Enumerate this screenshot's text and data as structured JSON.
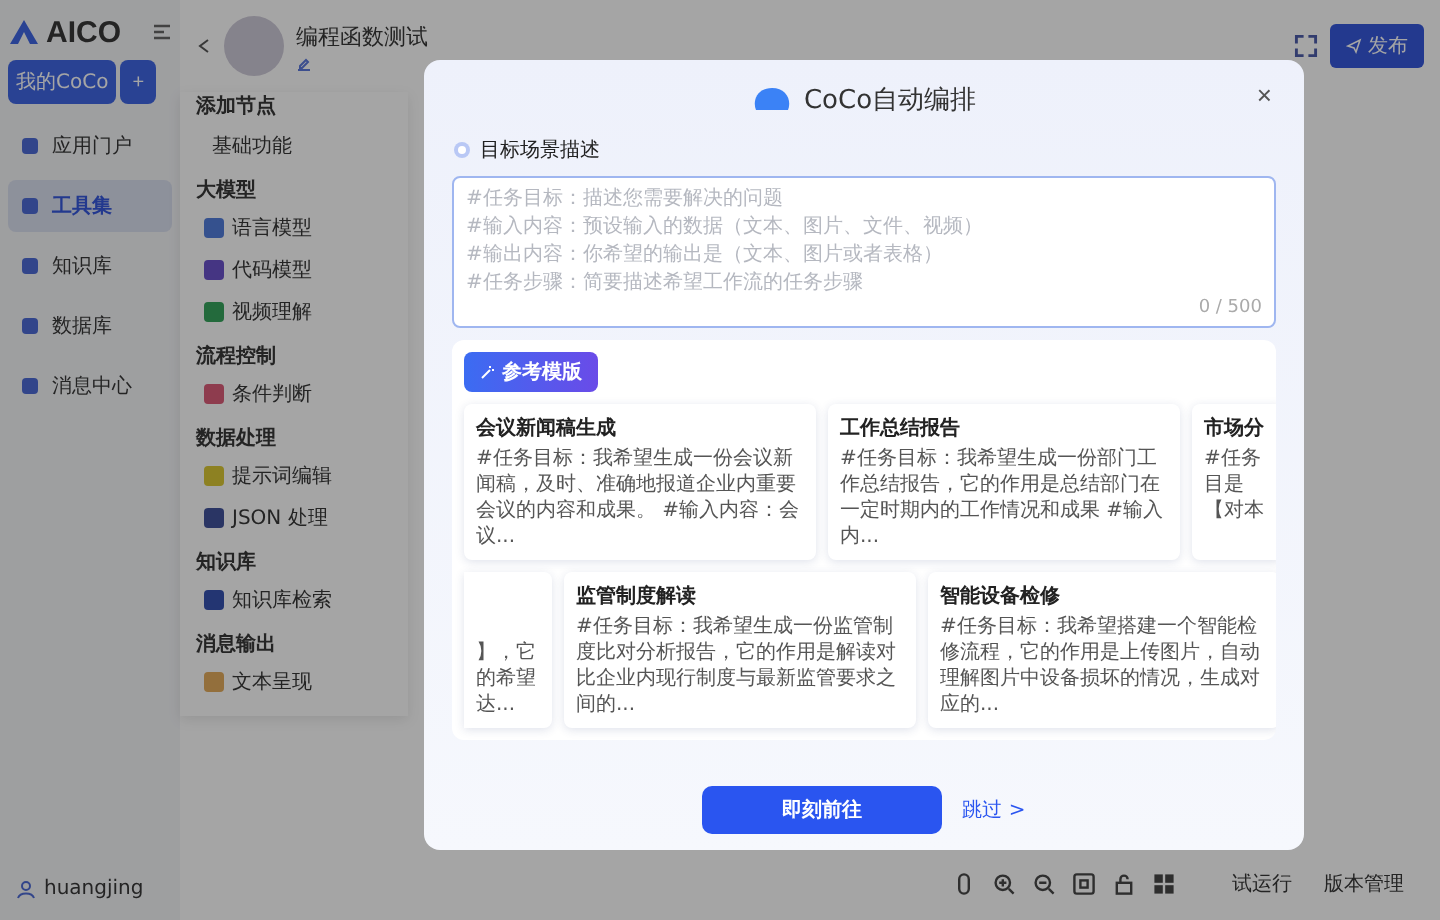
{
  "sidebar": {
    "logo": "AICO",
    "my_button": "我的CoCo",
    "add_button": "+",
    "items": [
      {
        "label": "应用门户",
        "selected": false
      },
      {
        "label": "工具集",
        "selected": true
      },
      {
        "label": "知识库",
        "selected": false
      },
      {
        "label": "数据库",
        "selected": false
      },
      {
        "label": "消息中心",
        "selected": false
      }
    ],
    "user": "huangjing"
  },
  "header": {
    "title": "编程函数测试",
    "publish": "发布"
  },
  "node_panel": {
    "title": "添加节点",
    "tab": "基础功能",
    "groups": [
      {
        "title": "大模型",
        "nodes": [
          {
            "label": "语言模型"
          },
          {
            "label": "代码模型"
          },
          {
            "label": "视频理解"
          }
        ]
      },
      {
        "title": "流程控制",
        "nodes": [
          {
            "label": "条件判断"
          }
        ]
      },
      {
        "title": "数据处理",
        "nodes": [
          {
            "label": "提示词编辑"
          },
          {
            "label": "JSON 处理"
          }
        ]
      },
      {
        "title": "知识库",
        "nodes": [
          {
            "label": "知识库检索"
          }
        ]
      },
      {
        "title": "消息输出",
        "nodes": [
          {
            "label": "文本呈现"
          }
        ]
      }
    ]
  },
  "toolbar": {
    "run": "试运行",
    "versions": "版本管理"
  },
  "dialog": {
    "title": "CoCo自动编排",
    "close": "×",
    "section": "目标场景描述",
    "placeholder": "#任务目标：描述您需要解决的问题\n#输入内容：预设输入的数据（文本、图片、文件、视频）\n#输出内容：你希望的输出是（文本、图片或者表格）\n#任务步骤：简要描述希望工作流的任务步骤",
    "counter": "0 / 500",
    "templates_tag": "参考模版",
    "template_rows": [
      [
        {
          "kind": "full",
          "title": "会议新闻稿生成",
          "text": "#任务目标：我希望生成一份会议新闻稿，及时、准确地报道企业内重要会议的内容和成果。 #输入内容：会议..."
        },
        {
          "kind": "full",
          "title": "工作总结报告",
          "text": "#任务目标：我希望生成一份部门工作总结报告，它的作用是总结部门在一定时期内的工作情况和成果 #输入内..."
        },
        {
          "kind": "cut_right",
          "title": "市场分",
          "text": "#任务目是【对本"
        }
      ],
      [
        {
          "kind": "cut_left",
          "text": "】，它的希望达..."
        },
        {
          "kind": "full",
          "title": "监管制度解读",
          "text": "#任务目标：我希望生成一份监管制度比对分析报告，它的作用是解读对比企业内现行制度与最新监管要求之间的..."
        },
        {
          "kind": "full",
          "title": "智能设备检修",
          "text": "#任务目标：我希望搭建一个智能检修流程，它的作用是上传图片，自动理解图片中设备损坏的情况，生成对应的..."
        }
      ]
    ],
    "primary_button": "即刻前往",
    "skip_link": "跳过 >"
  }
}
